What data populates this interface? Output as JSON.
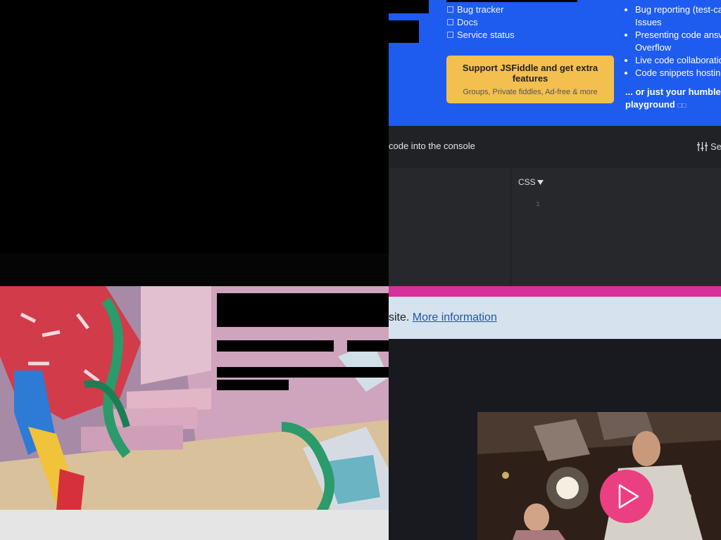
{
  "links": [
    {
      "label": "Bug tracker"
    },
    {
      "label": "Docs"
    },
    {
      "label": "Service status"
    }
  ],
  "support": {
    "title": "Support JSFiddle and get extra features",
    "subtitle": "Groups, Private fiddles, Ad-free & more"
  },
  "features": [
    "Bug reporting (test-ca",
    "Issues",
    "Presenting code answ",
    "Overflow",
    "Live code collaboratio",
    "Code snippets hostin"
  ],
  "humble": {
    "line1": "... or just your humble",
    "line2": "playground",
    "glyph": "□□"
  },
  "console": {
    "text": "code into the console",
    "settings_label": "Se"
  },
  "editor": {
    "css_label": "CSS",
    "line_number": "1"
  },
  "cookie": {
    "text": "site.",
    "link": "More information"
  },
  "colors": {
    "blue_panel": "#1e5cf0",
    "support_button": "#f3bf4f",
    "pink_strip": "#d6309a",
    "play_button": "#ea3f81",
    "editor_bg": "#26282c"
  },
  "icons": {
    "settings": "sliders-icon",
    "dropdown": "caret-down-icon",
    "play": "play-icon"
  }
}
